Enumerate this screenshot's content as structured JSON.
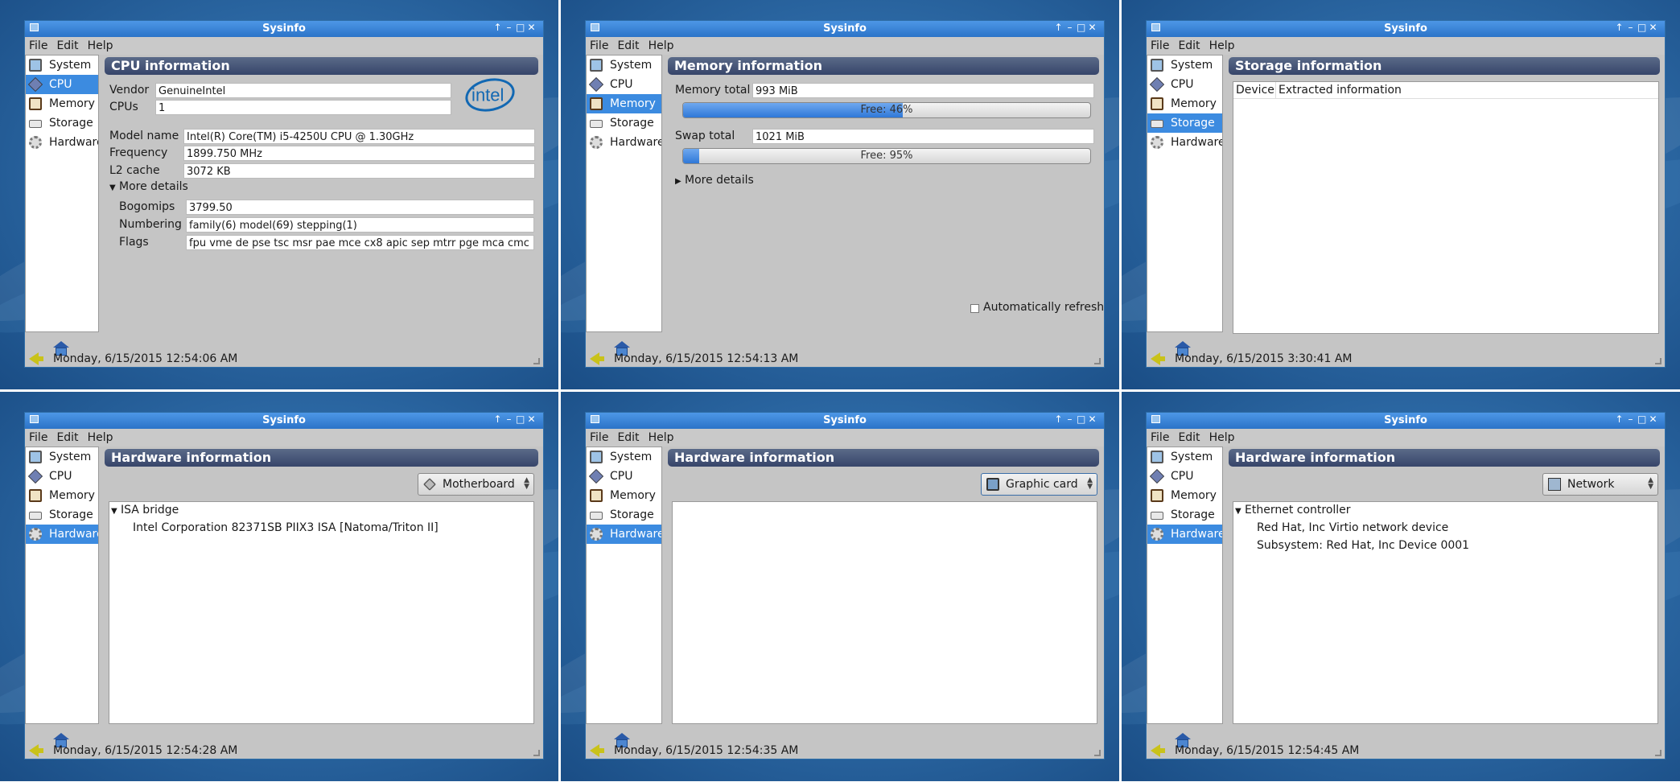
{
  "app_title": "Sysinfo",
  "menus": [
    "File",
    "Edit",
    "Help"
  ],
  "sidebar_items": [
    "System",
    "CPU",
    "Memory",
    "Storage",
    "Hardware"
  ],
  "cpu_window": {
    "header": "CPU information",
    "vendor_label": "Vendor",
    "vendor_value": "GenuineIntel",
    "cpus_label": "CPUs",
    "cpus_value": "1",
    "logo_text": "intel",
    "model_label": "Model name",
    "model_value": "Intel(R) Core(TM) i5-4250U CPU @ 1.30GHz",
    "freq_label": "Frequency",
    "freq_value": "1899.750 MHz",
    "l2_label": "L2 cache",
    "l2_value": "3072 KB",
    "more_details": "More details",
    "bogomips_label": "Bogomips",
    "bogomips_value": "3799.50",
    "numbering_label": "Numbering",
    "numbering_value": "family(6) model(69) stepping(1)",
    "flags_label": "Flags",
    "flags_value": "fpu vme de pse tsc msr pae mce cx8 apic sep mtrr pge mca cmc",
    "status": "Monday, 6/15/2015 12:54:06 AM"
  },
  "memory_window": {
    "header": "Memory information",
    "mem_total_label": "Memory total",
    "mem_total_value": "993 MiB",
    "mem_free_text": "Free: 46%",
    "mem_free_fraction": 0.54,
    "swap_total_label": "Swap total",
    "swap_total_value": "1021 MiB",
    "swap_free_text": "Free: 95%",
    "swap_free_fraction": 0.04,
    "more_details": "More details",
    "auto_refresh_label": "Automatically refresh",
    "status": "Monday, 6/15/2015 12:54:13 AM"
  },
  "storage_window": {
    "header": "Storage information",
    "col_device": "Device",
    "col_info": "Extracted information",
    "status": "Monday, 6/15/2015 3:30:41 AM"
  },
  "hw_motherboard_window": {
    "header": "Hardware information",
    "combo_value": "Motherboard",
    "tree_parent": "ISA bridge",
    "tree_child": "Intel Corporation 82371SB PIIX3 ISA [Natoma/Triton II]",
    "status": "Monday, 6/15/2015 12:54:28 AM"
  },
  "hw_graphics_window": {
    "header": "Hardware information",
    "combo_value": "Graphic card",
    "status": "Monday, 6/15/2015 12:54:35 AM"
  },
  "hw_network_window": {
    "header": "Hardware information",
    "combo_value": "Network",
    "tree_parent": "Ethernet controller",
    "tree_child_1": "Red Hat, Inc Virtio network device",
    "tree_child_2": "Subsystem: Red Hat, Inc Device 0001",
    "status": "Monday, 6/15/2015 12:54:45 AM"
  },
  "colors": {
    "titlebar": "#2b73c8",
    "selection": "#3c8be0",
    "header_bar": "#37456a",
    "desktop": "#2d6aa6"
  }
}
